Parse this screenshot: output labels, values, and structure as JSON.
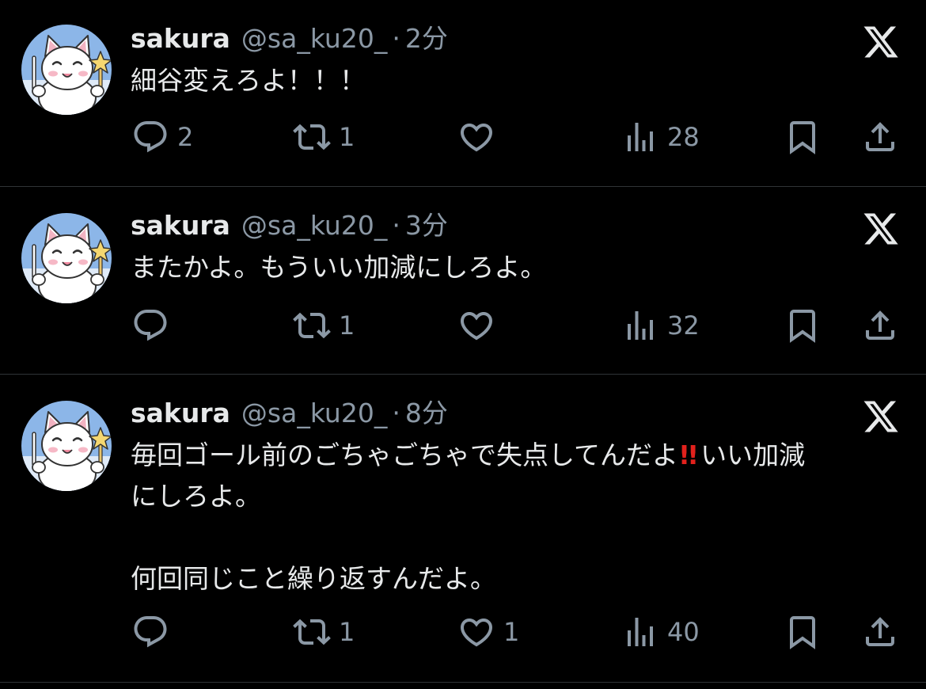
{
  "tweets": [
    {
      "name": "sakura",
      "handle": "@sa_ku20_",
      "separator": "·",
      "time": "2分",
      "text_lines": [
        "細谷変えろよ！！！"
      ],
      "replies": "2",
      "retweets": "1",
      "likes": "",
      "views": "28"
    },
    {
      "name": "sakura",
      "handle": "@sa_ku20_",
      "separator": "·",
      "time": "3分",
      "text_lines": [
        "またかよ。もういい加減にしろよ。"
      ],
      "replies": "",
      "retweets": "1",
      "likes": "",
      "views": "32"
    },
    {
      "name": "sakura",
      "handle": "@sa_ku20_",
      "separator": "·",
      "time": "8分",
      "text_line1_before": "毎回ゴール前のごちゃごちゃで失点してんだよ",
      "text_line1_emoji": "!!",
      "text_line1_after": "いい加減",
      "text_line2": "にしろよ。",
      "text_line3": "何回同じこと繰り返すんだよ。",
      "replies": "",
      "retweets": "1",
      "likes": "1",
      "views": "40"
    }
  ],
  "colors": {
    "background": "#000000",
    "text": "#e7e9ea",
    "secondary": "#8b98a5",
    "divider": "#2f3336",
    "emoji_red": "#e2211c"
  },
  "icons": [
    "reply-icon",
    "retweet-icon",
    "like-icon",
    "views-icon",
    "bookmark-icon",
    "share-icon",
    "x-logo-icon"
  ]
}
